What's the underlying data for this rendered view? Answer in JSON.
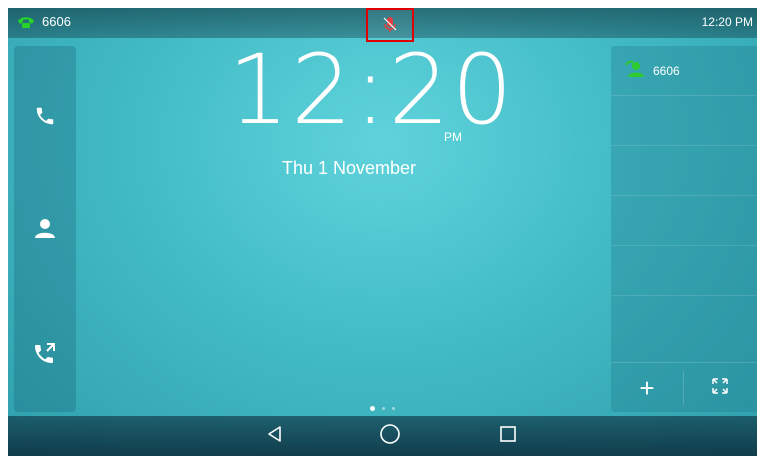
{
  "status_bar": {
    "account": "6606",
    "time": "12:20 PM"
  },
  "clock": {
    "time": "12:20",
    "ampm": "PM",
    "date": "Thu 1 November"
  },
  "left_sidebar": {
    "items": [
      {
        "icon": "phone-icon"
      },
      {
        "icon": "contacts-icon"
      },
      {
        "icon": "call-forward-icon"
      }
    ]
  },
  "right_panel": {
    "accounts": [
      {
        "label": "6606",
        "icon": "account-registered-icon",
        "status_color": "#2ecc2e"
      }
    ],
    "empty_slots": 4,
    "buttons": [
      {
        "icon": "plus-icon",
        "glyph": "+"
      },
      {
        "icon": "expand-icon"
      }
    ]
  },
  "indicators": {
    "mute_icon_color": "#e04040",
    "highlight_color": "#e00000"
  },
  "pager": {
    "pages": 3,
    "current": 1
  },
  "navbar": {
    "buttons": [
      "back-icon",
      "home-icon",
      "recent-apps-icon"
    ]
  }
}
